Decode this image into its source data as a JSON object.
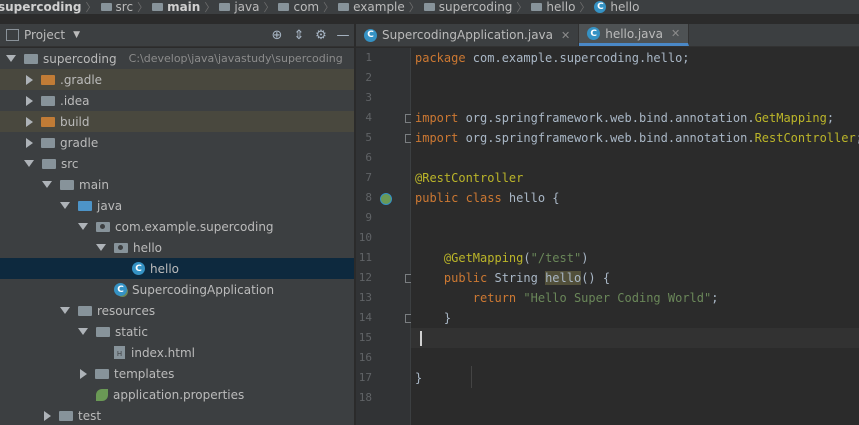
{
  "breadcrumb": [
    "supercoding",
    "src",
    "main",
    "java",
    "com",
    "example",
    "supercoding",
    "hello",
    "hello"
  ],
  "project_panel": {
    "title": "Project",
    "tree": [
      {
        "label": "supercoding",
        "path": "C:\\develop\\java\\javastudy\\supercoding",
        "level": 0,
        "arrow": "down",
        "icon": "folder-grey",
        "style": ""
      },
      {
        "label": ".gradle",
        "level": 1,
        "arrow": "right",
        "icon": "folder-orange",
        "style": "excluded"
      },
      {
        "label": ".idea",
        "level": 1,
        "arrow": "right",
        "icon": "folder-grey",
        "style": ""
      },
      {
        "label": "build",
        "level": 1,
        "arrow": "right",
        "icon": "folder-orange",
        "style": "excluded"
      },
      {
        "label": "gradle",
        "level": 1,
        "arrow": "right",
        "icon": "folder-grey",
        "style": ""
      },
      {
        "label": "src",
        "level": 1,
        "arrow": "down",
        "icon": "folder-grey",
        "style": ""
      },
      {
        "label": "main",
        "level": 2,
        "arrow": "down",
        "icon": "folder-grey",
        "style": ""
      },
      {
        "label": "java",
        "level": 3,
        "arrow": "down",
        "icon": "folder-blue",
        "style": ""
      },
      {
        "label": "com.example.supercoding",
        "level": 4,
        "arrow": "down",
        "icon": "package",
        "style": ""
      },
      {
        "label": "hello",
        "level": 5,
        "arrow": "down",
        "icon": "package",
        "style": ""
      },
      {
        "label": "hello",
        "level": 6,
        "arrow": "none",
        "icon": "class",
        "style": "selected"
      },
      {
        "label": "SupercodingApplication",
        "level": 5,
        "arrow": "none",
        "icon": "spring-class",
        "style": ""
      },
      {
        "label": "resources",
        "level": 3,
        "arrow": "down",
        "icon": "resources",
        "style": ""
      },
      {
        "label": "static",
        "level": 4,
        "arrow": "down",
        "icon": "folder-grey",
        "style": ""
      },
      {
        "label": "index.html",
        "level": 5,
        "arrow": "none",
        "icon": "html",
        "style": ""
      },
      {
        "label": "templates",
        "level": 4,
        "arrow": "right",
        "icon": "folder-grey",
        "style": ""
      },
      {
        "label": "application.properties",
        "level": 4,
        "arrow": "none",
        "icon": "properties",
        "style": ""
      },
      {
        "label": "test",
        "level": 2,
        "arrow": "right",
        "icon": "folder-grey",
        "style": ""
      }
    ]
  },
  "tabs": [
    {
      "label": "SupercodingApplication.java",
      "active": false
    },
    {
      "label": "hello.java",
      "active": true
    }
  ],
  "editor": {
    "line_numbers": [
      "1",
      "2",
      "3",
      "4",
      "5",
      "6",
      "7",
      "8",
      "9",
      "10",
      "11",
      "12",
      "13",
      "14",
      "15",
      "16",
      "17",
      "18"
    ],
    "current_line": 15,
    "lines": [
      [
        [
          "kw",
          "package "
        ],
        [
          "t",
          "com.example.supercoding.hello;"
        ]
      ],
      [],
      [],
      [
        [
          "kw",
          "import "
        ],
        [
          "t",
          "org.springframework.web.bind.annotation."
        ],
        [
          "ann",
          "GetMapping"
        ],
        [
          "t",
          ";"
        ]
      ],
      [
        [
          "kw",
          "import "
        ],
        [
          "t",
          "org.springframework.web.bind.annotation."
        ],
        [
          "ann",
          "RestController"
        ],
        [
          "t",
          ";"
        ]
      ],
      [],
      [
        [
          "ann",
          "@RestController"
        ]
      ],
      [
        [
          "kw",
          "public class "
        ],
        [
          "t",
          "hello {"
        ]
      ],
      [],
      [],
      [
        [
          "t",
          "    "
        ],
        [
          "ann",
          "@GetMapping"
        ],
        [
          "t",
          "("
        ],
        [
          "str",
          "\"/test\""
        ],
        [
          "t",
          ")"
        ]
      ],
      [
        [
          "t",
          "    "
        ],
        [
          "kw",
          "public "
        ],
        [
          "t",
          "String "
        ],
        [
          "hl",
          "hello"
        ],
        [
          "t",
          "() {"
        ]
      ],
      [
        [
          "t",
          "        "
        ],
        [
          "kw",
          "return "
        ],
        [
          "str",
          "\"Hello Super Coding World\""
        ],
        [
          "t",
          ";"
        ]
      ],
      [
        [
          "t",
          "    }"
        ]
      ],
      [],
      [],
      [
        [
          "t",
          "}"
        ]
      ],
      []
    ]
  }
}
